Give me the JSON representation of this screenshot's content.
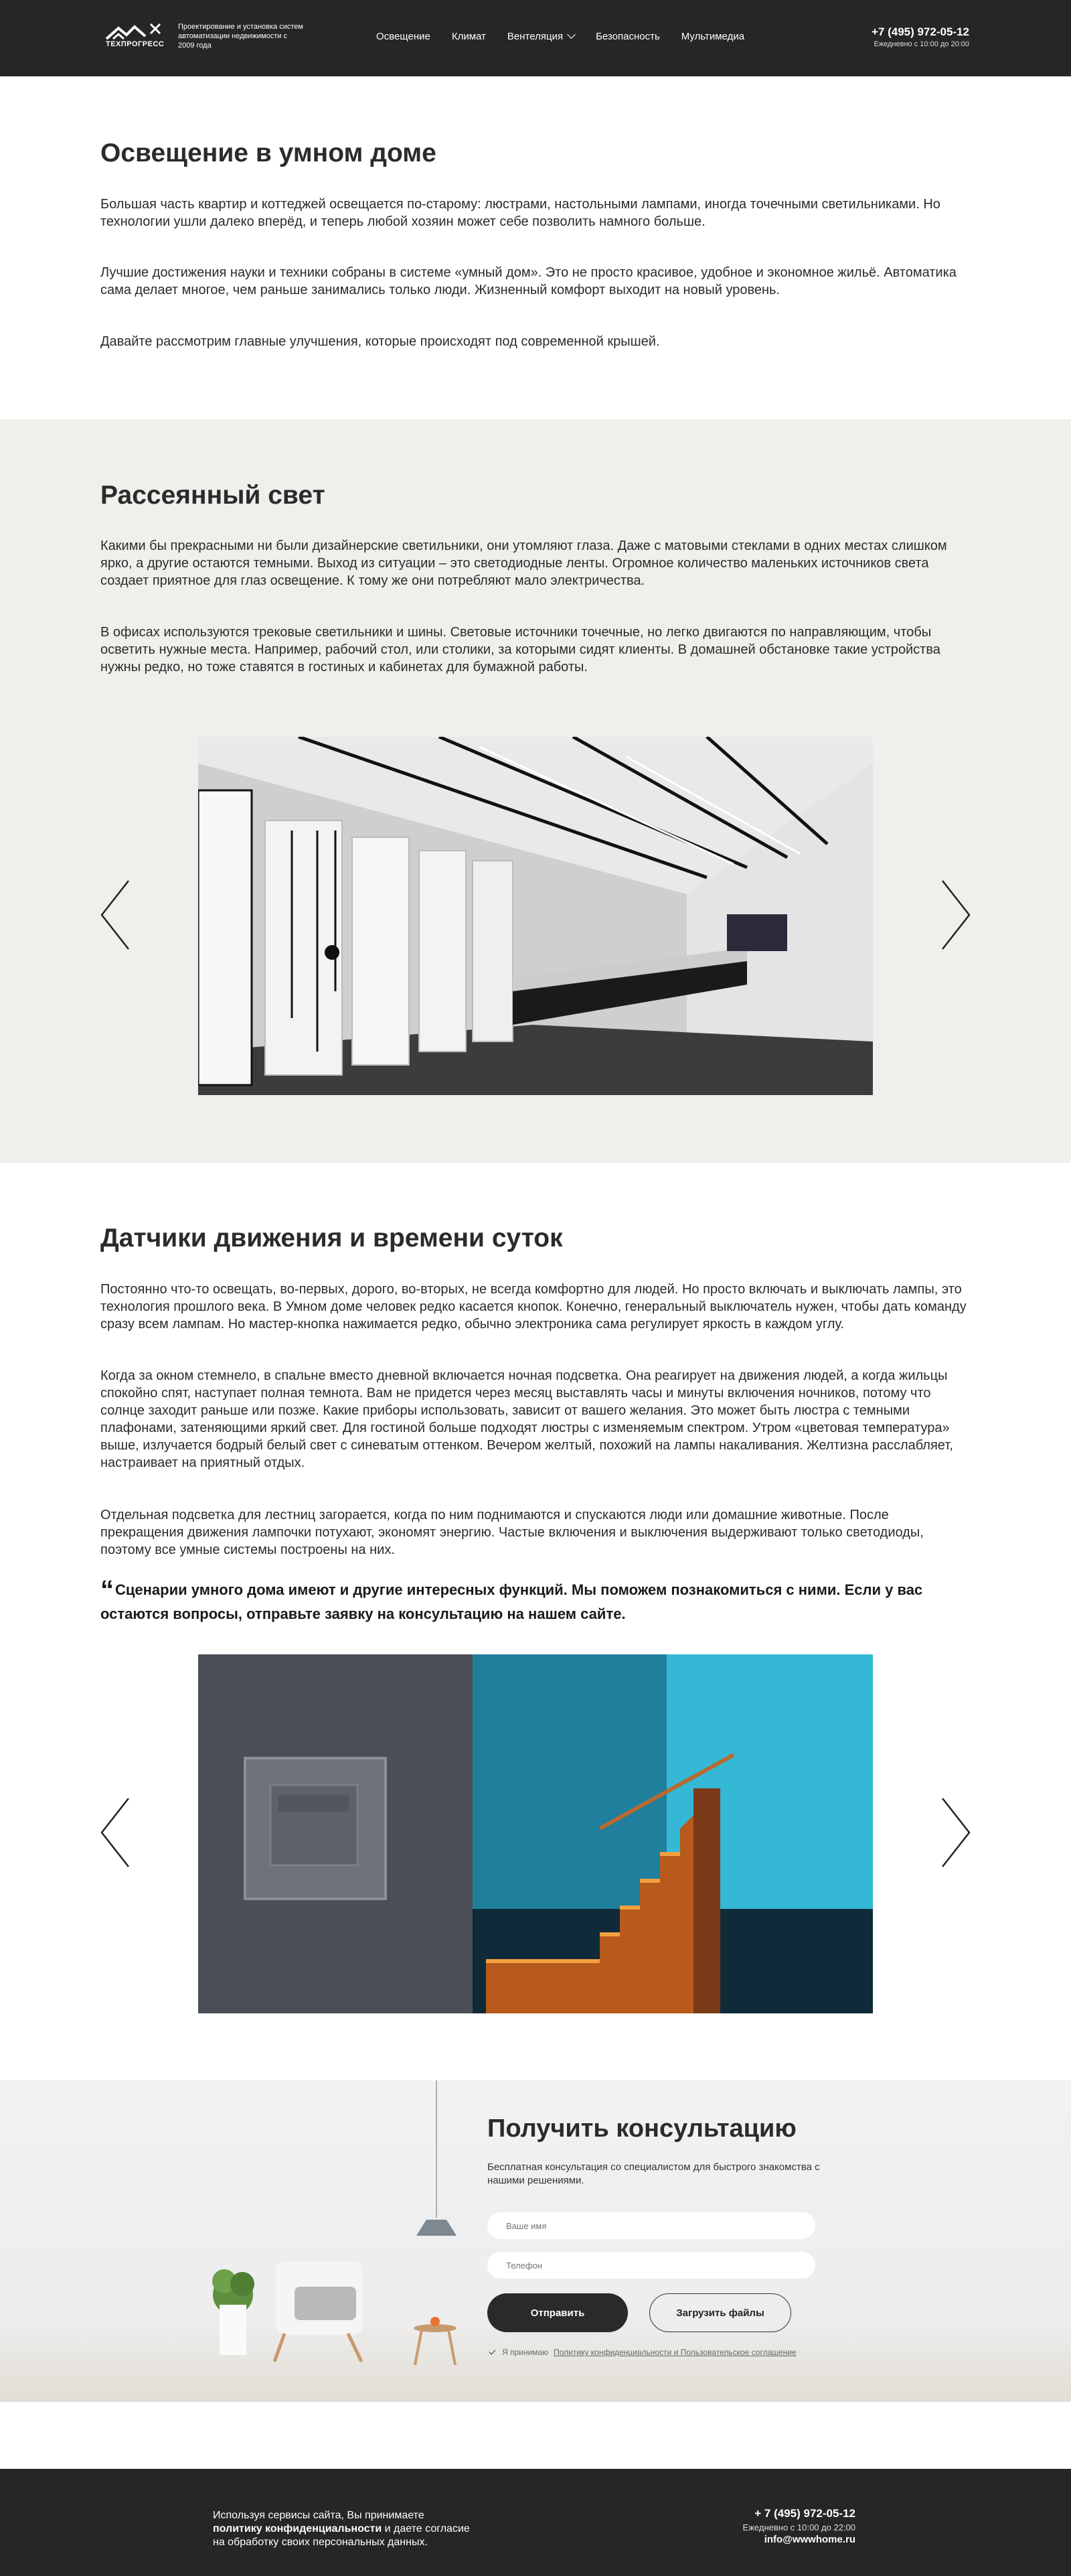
{
  "header": {
    "logo_text": "ТЕХПРОГРЕСС",
    "tagline": "Проектирование и установка систем автоматизации недвижимости с 2009 года",
    "nav": [
      "Освещение",
      "Климат",
      "Вентеляция",
      "Безопасность",
      "Мультимедиа"
    ],
    "phone": "+7 (495) 972-05-12",
    "hours": "Ежедневно с 10:00 до 20:00"
  },
  "intro": {
    "title": "Освещение в умном доме",
    "p1": "Большая часть квартир и коттеджей освещается по-старому: люстрами, настольными лампами, иногда точечными светильниками. Но технологии ушли далеко вперёд, и теперь любой хозяин может себе позволить намного больше.",
    "p2": "Лучшие достижения науки и техники собраны в системе «умный дом». Это не просто красивое, удобное и экономное жильё. Автоматика сама делает многое, чем раньше занимались только люди. Жизненный комфорт выходит на новый уровень.",
    "p3": "Давайте рассмотрим главные улучшения, которые происходят под современной крышей."
  },
  "diffuse": {
    "title": "Рассеянный свет",
    "p1": "Какими бы прекрасными ни были дизайнерские светильники, они утомляют глаза. Даже с матовыми стеклами в одних местах слишком ярко, а другие остаются темными. Выход из ситуации – это светодиодные ленты. Огромное количество маленьких источников света создает приятное для глаз освещение. К тому же они потребляют мало электричества.",
    "p2": "В офисах используются трековые светильники и шины. Световые источники точечные, но легко двигаются по направляющим, чтобы осветить нужные места. Например, рабочий стол, или столики, за которыми сидят клиенты. В домашней обстановке такие устройства нужны редко, но тоже ставятся в гостиных и кабинетах для бумажной работы."
  },
  "sensors": {
    "title": "Датчики движения и времени суток",
    "p1": "Постоянно что-то освещать, во-первых, дорого, во-вторых, не всегда комфортно для людей. Но просто включать и выключать лампы, это технология прошлого века. В Умном доме человек редко касается кнопок. Конечно, генеральный выключатель нужен, чтобы дать команду сразу всем лампам. Но мастер-кнопка нажимается редко, обычно электроника сама регулирует яркость в каждом углу.",
    "p2": "Когда за окном стемнело, в спальне вместо дневной включается ночная подсветка. Она реагирует на движения людей, а когда жильцы спокойно спят, наступает полная темнота. Вам не придется через месяц выставлять часы и минуты включения ночников, потому что солнце заходит раньше или позже. Какие приборы использовать, зависит от вашего желания. Это может быть люстра с темными плафонами, затеняющими яркий свет. Для гостиной больше подходят люстры с изменяемым спектром. Утром «цветовая температура» выше, излучается бодрый белый свет с синеватым оттенком. Вечером желтый, похожий на лампы накаливания. Желтизна расслабляет, настраивает на приятный отдых.",
    "p3": "Отдельная подсветка для лестниц загорается, когда по ним поднимаются и спускаются люди или домашние животные. После прекращения движения лампочки потухают, экономят энергию. Частые включения и выключения выдерживают только светодиоды, поэтому все умные системы построены на них.",
    "quote_mark": "“",
    "quote": "Сценарии умного дома имеют и другие интересных функций. Мы поможем познакомиться с ними. Если у вас остаются вопросы, отправьте заявку на консультацию на нашем сайте."
  },
  "consult": {
    "title": "Получить консультацию",
    "subtitle": "Бесплатная консультация со специалистом для быстрого знакомства с нашими решениями.",
    "name_placeholder": "Ваше имя",
    "phone_placeholder": "Телефон",
    "send_label": "Отправить",
    "files_label": "Загрузить файлы",
    "agree_text": "Я принимаю",
    "agree_link": "Политику конфиденциальности и Пользовательское соглашение"
  },
  "footer": {
    "note_1": "Используя сервисы сайта, Вы принимаете",
    "note_2": "политику конфиденциальности",
    "note_3": " и даете согласие",
    "note_4": "на обработку своих персональных данных.",
    "phone": "+ 7 (495) 972-05-12",
    "hours": "Ежедневно с 10:00 до 22:00",
    "email": "info@wwwhome.ru"
  },
  "colors": {
    "dark": "#262626",
    "section_beige": "#f1efec",
    "text": "#2b2b2b",
    "stair_blue": "#2aa8c8",
    "stair_orange": "#e07a28"
  },
  "icons": [
    "logo-house-icon",
    "arrow-left-icon",
    "arrow-right-icon",
    "chevron-down-icon",
    "checkmark-icon"
  ]
}
